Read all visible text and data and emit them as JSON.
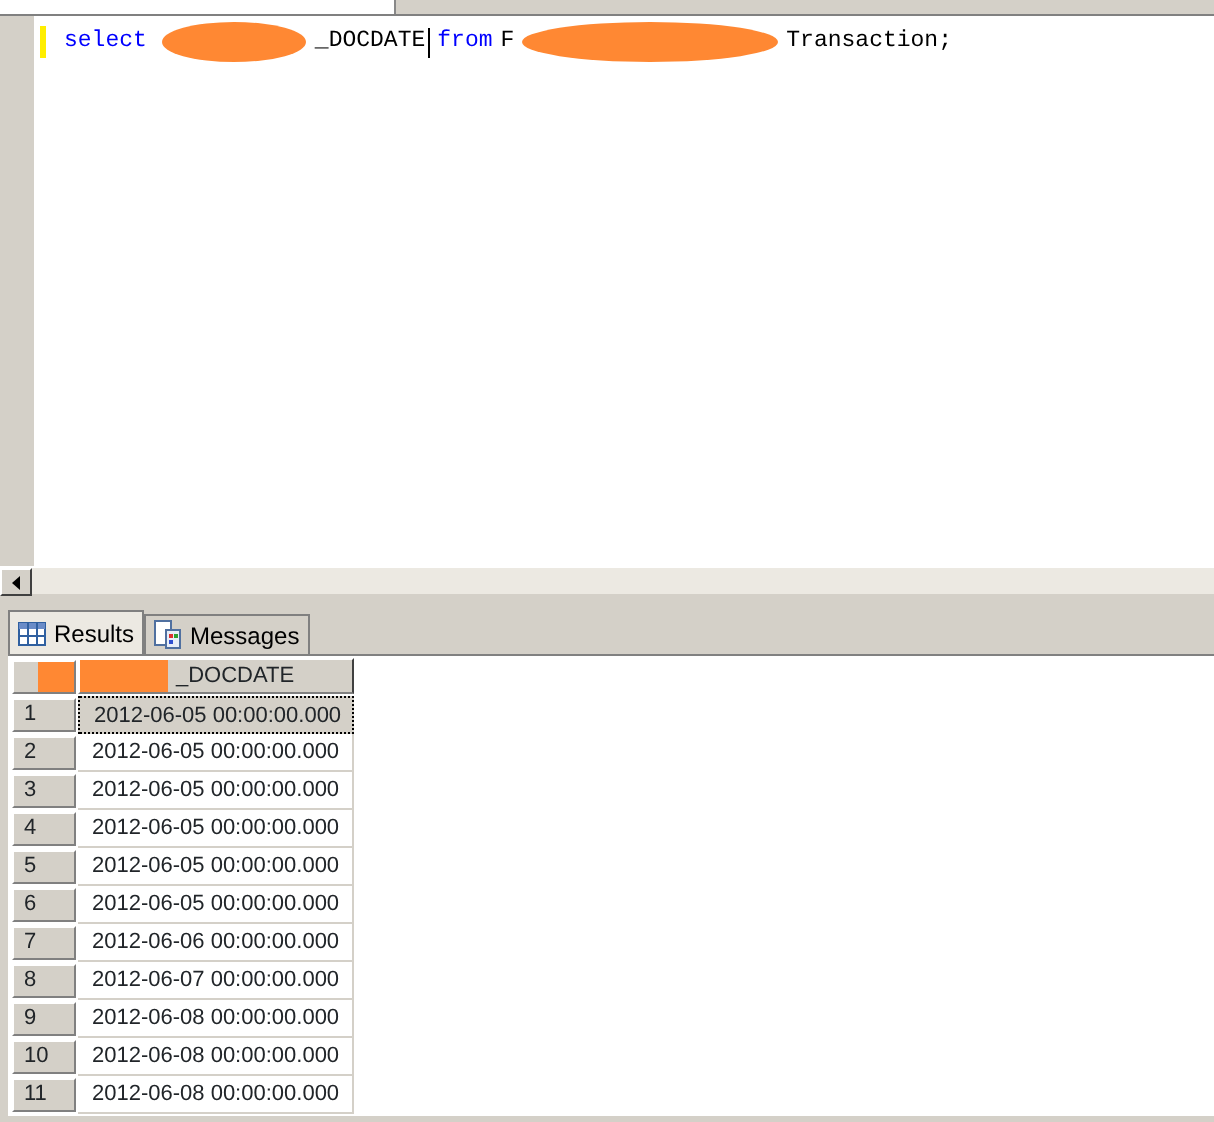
{
  "editor": {
    "tokens": [
      {
        "kind": "keyword",
        "text": "select"
      },
      {
        "kind": "redaction"
      },
      {
        "kind": "plain",
        "text": "_DOCDATE"
      },
      {
        "kind": "caret"
      },
      {
        "kind": "keyword",
        "text": "from"
      },
      {
        "kind": "plain",
        "text": "F"
      },
      {
        "kind": "redaction"
      },
      {
        "kind": "plain",
        "text": "Transaction;"
      }
    ]
  },
  "result_tabs": [
    {
      "label": "Results",
      "selected": true
    },
    {
      "label": "Messages",
      "selected": false
    }
  ],
  "grid": {
    "header": "_DOCDATE",
    "header_redacted": true,
    "rows": [
      {
        "number": "1",
        "value": "2012-06-05 00:00:00.000",
        "selected": true
      },
      {
        "number": "2",
        "value": "2012-06-05 00:00:00.000",
        "selected": false
      },
      {
        "number": "3",
        "value": "2012-06-05 00:00:00.000",
        "selected": false
      },
      {
        "number": "4",
        "value": "2012-06-05 00:00:00.000",
        "selected": false
      },
      {
        "number": "5",
        "value": "2012-06-05 00:00:00.000",
        "selected": false
      },
      {
        "number": "6",
        "value": "2012-06-05 00:00:00.000",
        "selected": false
      },
      {
        "number": "7",
        "value": "2012-06-06 00:00:00.000",
        "selected": false
      },
      {
        "number": "8",
        "value": "2012-06-07 00:00:00.000",
        "selected": false
      },
      {
        "number": "9",
        "value": "2012-06-08 00:00:00.000",
        "selected": false
      },
      {
        "number": "10",
        "value": "2012-06-08 00:00:00.000",
        "selected": false
      },
      {
        "number": "11",
        "value": "2012-06-08 00:00:00.000",
        "selected": false
      }
    ]
  }
}
